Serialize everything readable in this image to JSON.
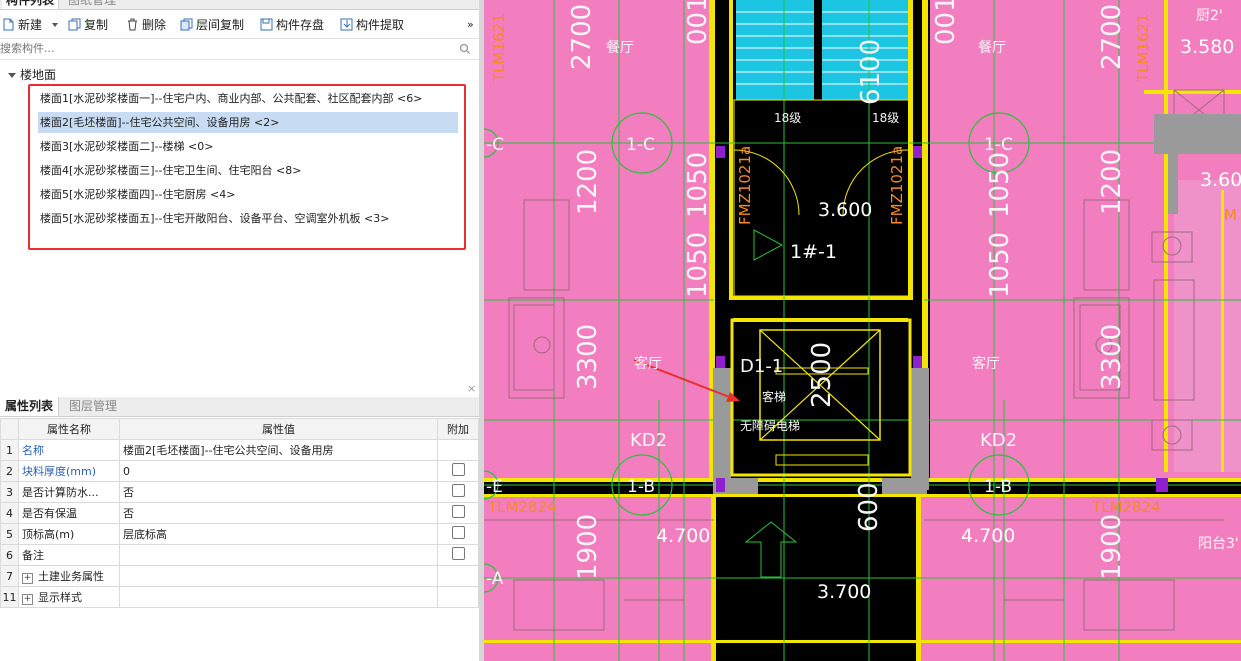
{
  "top_tabs": [
    "构件列表",
    "图纸管理"
  ],
  "toolbar": {
    "new_label": "新建",
    "copy_label": "复制",
    "delete_label": "删除",
    "floor_copy_label": "层间复制",
    "save_label": "构件存盘",
    "extract_label": "构件提取",
    "more_label": "»"
  },
  "search": {
    "placeholder": "搜索构件..."
  },
  "tree": {
    "root_label": "楼地面",
    "items": [
      {
        "label": "楼面1[水泥砂浆楼面一]--住宅户内、商业内部、公共配套、社区配套内部 <6>",
        "selected": false
      },
      {
        "label": "楼面2[毛坯楼面]--住宅公共空间、设备用房 <2>",
        "selected": true
      },
      {
        "label": "楼面3[水泥砂浆楼面二]--楼梯 <0>",
        "selected": false
      },
      {
        "label": "楼面4[水泥砂浆楼面三]--住宅卫生间、住宅阳台 <8>",
        "selected": false
      },
      {
        "label": "楼面5[水泥砂浆楼面四]--住宅厨房 <4>",
        "selected": false
      },
      {
        "label": "楼面5[水泥砂浆楼面五]--住宅开敞阳台、设备平台、空调室外机板 <3>",
        "selected": false
      }
    ]
  },
  "close_glyph": "×",
  "prop_tabs": [
    "属性列表",
    "图层管理"
  ],
  "prop_table": {
    "headers": [
      "属性名称",
      "属性值",
      "附加"
    ],
    "rows": [
      {
        "num": "1",
        "name": "名称",
        "value": "楼面2[毛坯楼面]--住宅公共空间、设备用房",
        "checkbox": false,
        "blue": true,
        "expand": false
      },
      {
        "num": "2",
        "name": "块料厚度(mm)",
        "value": "0",
        "checkbox": true,
        "blue": true,
        "expand": false
      },
      {
        "num": "3",
        "name": "是否计算防水...",
        "value": "否",
        "checkbox": true,
        "blue": false,
        "expand": false
      },
      {
        "num": "4",
        "name": "是否有保温",
        "value": "否",
        "checkbox": true,
        "blue": false,
        "expand": false
      },
      {
        "num": "5",
        "name": "顶标高(m)",
        "value": "层底标高",
        "checkbox": true,
        "blue": false,
        "expand": false
      },
      {
        "num": "6",
        "name": "备注",
        "value": "",
        "checkbox": true,
        "blue": false,
        "expand": false
      },
      {
        "num": "7",
        "name": "土建业务属性",
        "value": "",
        "checkbox": false,
        "blue": false,
        "expand": true
      },
      {
        "num": "11",
        "name": "显示样式",
        "value": "",
        "checkbox": false,
        "blue": false,
        "expand": true
      }
    ]
  },
  "cad": {
    "dims": {
      "d2700_l": "2700",
      "d2700_r": "2700",
      "d1200_l": "1200",
      "d1050_l": "1050",
      "d1200_r": "1200",
      "d1050_r": "1050",
      "d1050_ml": "1050",
      "d1050_mr": "1050",
      "d3300_l": "3300",
      "d3300_r": "3300",
      "d1900_l": "1900",
      "d1900_r": "1900",
      "d6100": "6100",
      "d600": "600",
      "d2500": "2500",
      "d001_l": "001",
      "d001_r": "001"
    },
    "elevations": {
      "e3600": "3.600",
      "e3580": "3.580",
      "e3600r": "3.60",
      "e4700l": "4.700",
      "e4700r": "4.700",
      "e3700": "3.700"
    },
    "rooms": {
      "dining_l": "餐厅",
      "dining_r": "餐厅",
      "living_l": "客厅",
      "living_r": "客厅",
      "kitchen": "厨2'",
      "balcony": "阳台3'",
      "stair": "1#-1"
    },
    "axes": {
      "axis_c_l": "1-C",
      "axis_c_r": "1-C",
      "axis_b_l": "1-B",
      "axis_b_r": "1-B",
      "edge_c": "-C",
      "edge_e": "-E",
      "edge_a": "-A"
    },
    "doors": {
      "tlm_top_l": "TLM1621",
      "tlm_top_r": "TLM1621",
      "fm_l": "FMZ1021a",
      "fm_r": "FMZ1021a",
      "tlm_bot_l": "TLM2824",
      "tlm_bot_r": "TLM2824",
      "kd_l": "KD2",
      "kd_r": "KD2",
      "m_r": "M"
    },
    "elevator": {
      "code": "D1-1",
      "passenger": "客梯",
      "barrier_free": "无障碍电梯"
    },
    "stair_labels": {
      "s18_l": "18级",
      "s18_r": "18级"
    }
  }
}
